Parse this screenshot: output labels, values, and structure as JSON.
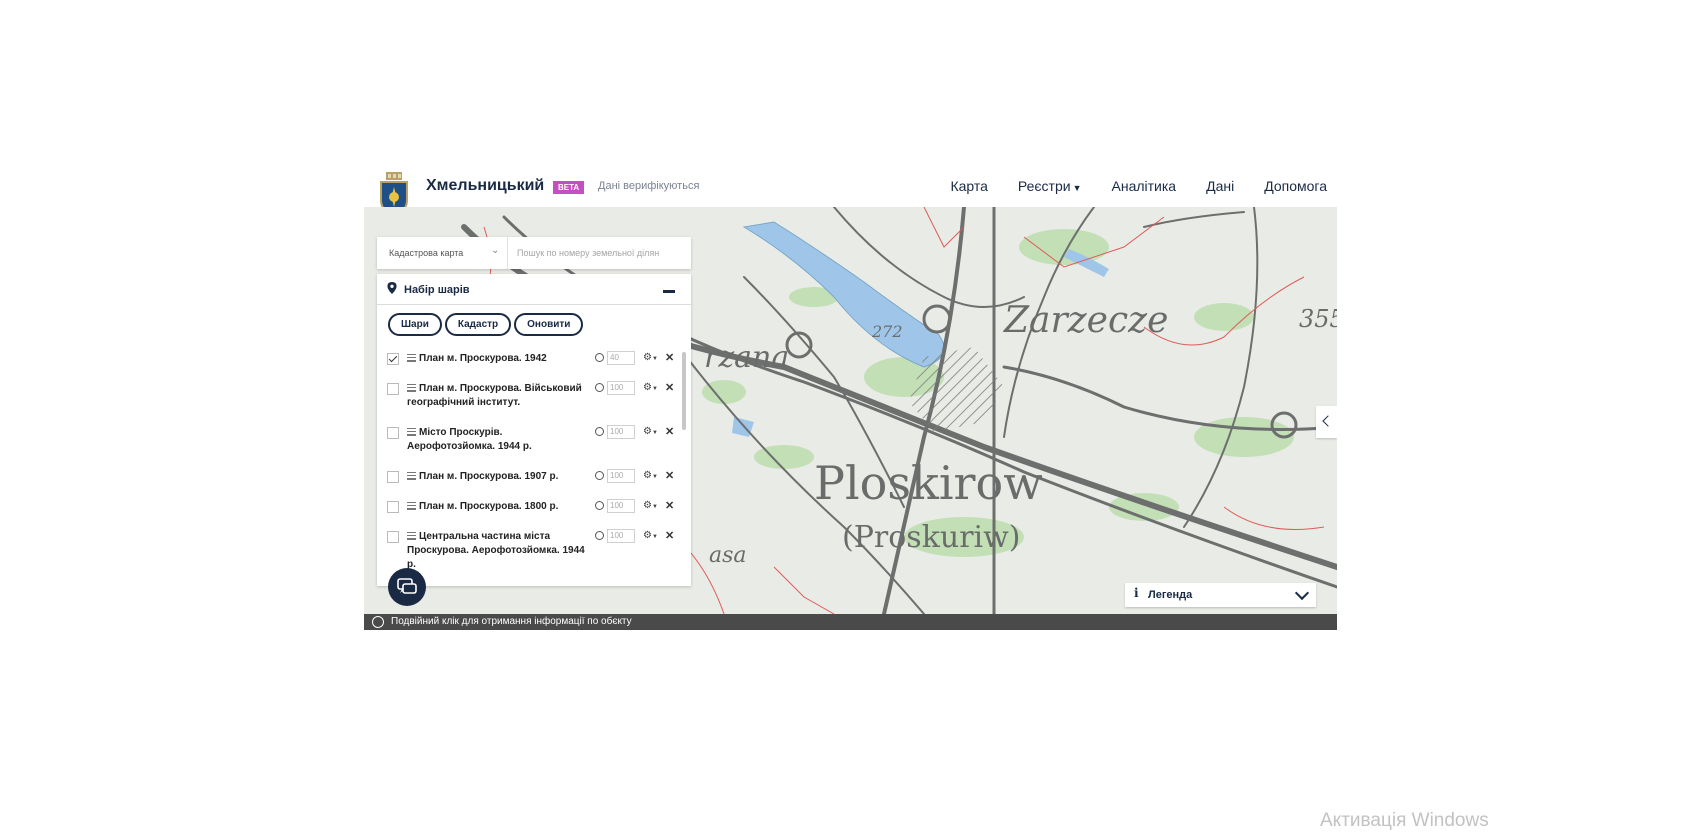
{
  "header": {
    "brand": "Хмельницький",
    "beta": "BETA",
    "verify_note": "Дані верифікуються",
    "nav": [
      {
        "label": "Карта"
      },
      {
        "label": "Реєстри"
      },
      {
        "label": "Аналітика"
      },
      {
        "label": "Дані"
      },
      {
        "label": "Допомога"
      }
    ],
    "nav_dropdown_icon": "chevron-down-icon"
  },
  "map": {
    "labels": [
      "Ploskirow",
      "(Proskuriw)",
      "Zarzecze",
      "rzana",
      "asa",
      "272",
      "355"
    ]
  },
  "search": {
    "select_value": "Кадастрова карта",
    "placeholder": "Пошук по номеру земельної ділян"
  },
  "layers_panel": {
    "title": "Набір шарів",
    "tabs": [
      "Шари",
      "Кадастр",
      "Оновити"
    ],
    "layers": [
      {
        "name": "План м. Проскурова. 1942",
        "checked": true,
        "opacity": "40"
      },
      {
        "name": "План м. Проскурова. Військовий географічний інститут.",
        "checked": false,
        "opacity": "100"
      },
      {
        "name": "Місто Проскурів. Аерофотозйомка. 1944 р.",
        "checked": false,
        "opacity": "100"
      },
      {
        "name": "План м. Проскурова. 1907 р.",
        "checked": false,
        "opacity": "100"
      },
      {
        "name": "План м. Проскурова. 1800 р.",
        "checked": false,
        "opacity": "100"
      },
      {
        "name": "Центральна частина міста Проскурова. Аерофотозйомка. 1944 р.",
        "checked": false,
        "opacity": "100"
      }
    ]
  },
  "legend": {
    "label": "Легенда"
  },
  "status_bar": {
    "text": "Подвійний клік для отримання інформації по обєкту"
  },
  "os_watermark": "Активація Windows",
  "colors": {
    "navy": "#1a2a44",
    "beta": "#c44fc0",
    "map_background": "#e9ece6",
    "status_bar": "#4a4a4a"
  }
}
